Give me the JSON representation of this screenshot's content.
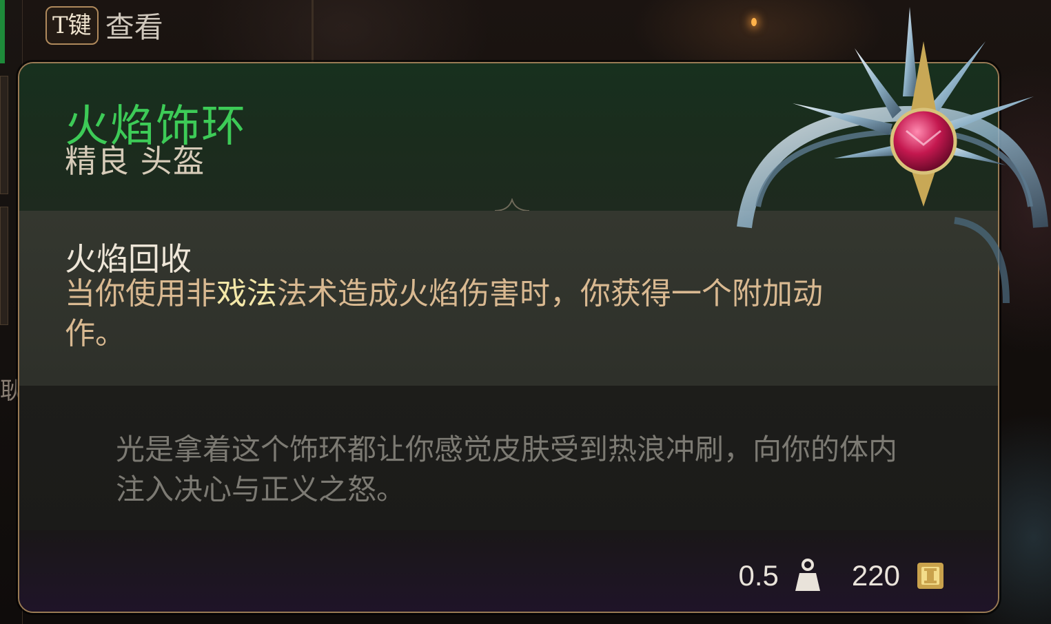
{
  "key_hint": {
    "key": "T键",
    "label": "查看"
  },
  "item": {
    "name": "火焰饰环",
    "rarity_type": "精良 头盔",
    "effect": {
      "title": "火焰回收",
      "desc_before": "当你使用非",
      "desc_keyword": "戏法",
      "desc_after": "法术造成火焰伤害时，你获得一个附加动作。"
    },
    "flavor": "光是拿着这个饰环都让你感觉皮肤受到热浪冲刷，向你的体内注入决心与正义之怒。",
    "weight": "0.5",
    "value": "220"
  },
  "side_glyph": "耿",
  "colors": {
    "name_green": "#3dcb57",
    "keyword_yellow": "#f3e7a8",
    "desc_gold": "#d9b991",
    "border_bronze": "#9a7b55"
  },
  "icons": {
    "weight": "weight-icon",
    "gold": "gold-coin-icon",
    "item": "flame-circlet-icon"
  }
}
